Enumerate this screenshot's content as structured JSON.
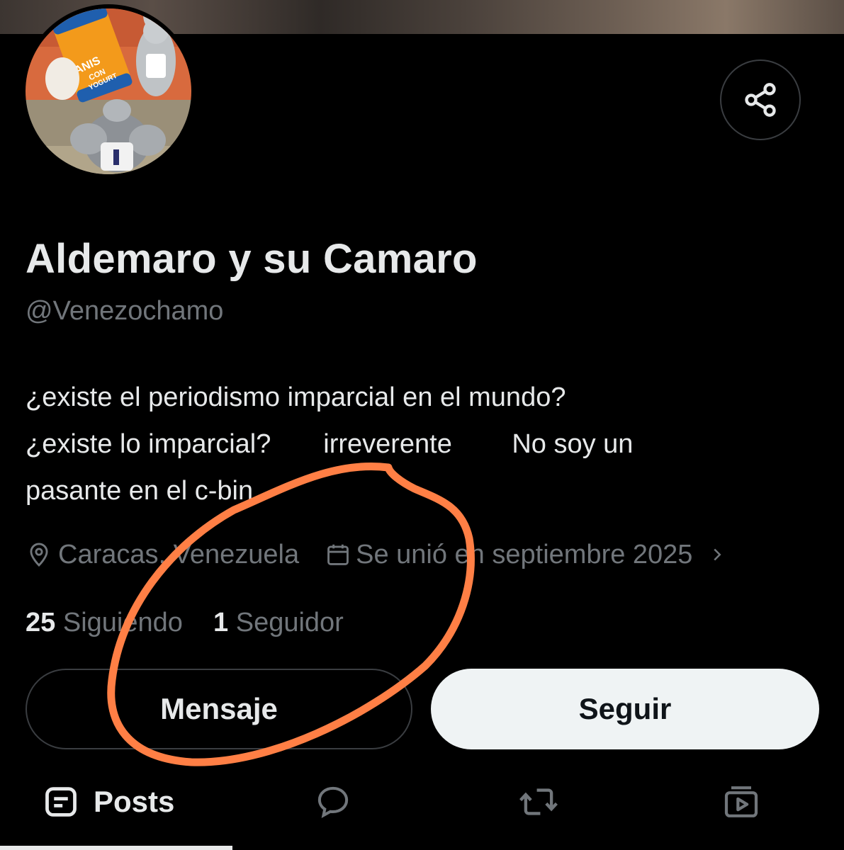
{
  "profile": {
    "display_name": "Aldemaro y su Camaro",
    "handle": "@Venezochamo",
    "avatar_text": {
      "line1": "ANIS",
      "line2": "CON",
      "line3": "YOGURT"
    },
    "bio_lines": [
      "¿existe el periodismo imparcial en el mundo?",
      "¿existe lo imparcial?       irreverente        No soy un",
      "pasante en el c-bin"
    ],
    "location": "Caracas, Venezuela",
    "joined": "Se unió en septiembre 2025"
  },
  "stats": {
    "following_count": "25",
    "following_label": "Siguiendo",
    "followers_count": "1",
    "followers_label": "Seguidor"
  },
  "actions": {
    "message_label": "Mensaje",
    "follow_label": "Seguir"
  },
  "tabs": {
    "posts_label": "Posts",
    "icons": [
      "posts-icon",
      "replies-icon",
      "reposts-icon",
      "media-icon"
    ]
  },
  "colors": {
    "background": "#000000",
    "primary_text": "#e7e9ea",
    "secondary_text": "#71767b",
    "follow_button_bg": "#eff3f4",
    "border": "#3a3d41",
    "annotation_stroke": "#ff7f45"
  }
}
